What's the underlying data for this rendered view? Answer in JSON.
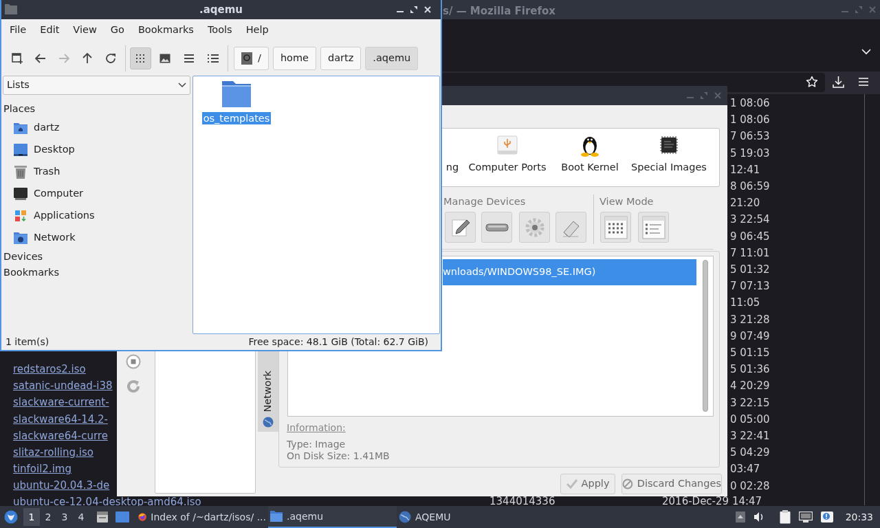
{
  "firefox": {
    "title": "s/ — Mozilla Firefox",
    "names": [
      "redstaros2.iso",
      "satanic-undead-i38",
      "slackware-current-",
      "slackware64-14.2-",
      "slackware64-curre",
      "slitaz-rolling.iso",
      "tinfoil2.img",
      "ubuntu-20.04.3-de",
      "ubuntu-ce-12.04-desktop-amd64.iso"
    ],
    "times": [
      "1 08:06",
      "1 08:06",
      "7 06:53",
      "5 19:03",
      "12:41",
      "8 06:59",
      "21:20",
      "3 22:54",
      "9 06:45",
      "7 11:01",
      "5 01:32",
      "7 07:13",
      "11:05",
      "3 21:28",
      "9 07:49",
      "5 01:15",
      "5 01:36",
      "4 20:29",
      "3 22:15",
      "0 05:00",
      "3 22:41",
      "5 04:29",
      "03:47",
      "0 02:28"
    ],
    "last_size": "1344014336",
    "last_date": "2016-Dec-29 14:47"
  },
  "aqemu": {
    "tool_items": [
      {
        "label": "ng",
        "kind": "hidden"
      },
      {
        "label": "Computer Ports",
        "kind": "usb"
      },
      {
        "label": "Boot Kernel",
        "kind": "penguin"
      },
      {
        "label": "Special Images",
        "kind": "chip"
      }
    ],
    "manage_label": "Manage Devices",
    "view_label": "View Mode",
    "devices": [
      {
        "label": "wnloads/WINDOWS98_SE.IMG)",
        "selected": true
      }
    ],
    "side_tab": "Network",
    "info_title": "Information:",
    "info_lines": [
      "Type: Image",
      "On Disk Size: 1.41MB"
    ],
    "buttons": [
      "Apply",
      "Discard Changes"
    ]
  },
  "file_manager": {
    "title": ".aqemu",
    "menu": [
      "File",
      "Edit",
      "View",
      "Go",
      "Bookmarks",
      "Tools",
      "Help"
    ],
    "nav_buttons": [
      {
        "disabled": false
      },
      {
        "disabled": true
      },
      {
        "disabled": false
      },
      {
        "disabled": false
      }
    ],
    "view_modes": [
      {
        "selected": true
      },
      {
        "selected": false
      },
      {
        "selected": false
      },
      {
        "selected": false
      }
    ],
    "path": [
      {
        "label": "/",
        "selected": false
      },
      {
        "label": "home",
        "selected": false
      },
      {
        "label": "dartz",
        "selected": false
      },
      {
        "label": ".aqemu",
        "selected": true
      }
    ],
    "side_mode": "Lists",
    "sections": [
      {
        "title": "Places",
        "items": [
          {
            "label": "dartz",
            "kind": "home"
          },
          {
            "label": "Desktop",
            "kind": "desktop"
          },
          {
            "label": "Trash",
            "kind": "trash"
          },
          {
            "label": "Computer",
            "kind": "computer"
          },
          {
            "label": "Applications",
            "kind": "apps"
          },
          {
            "label": "Network",
            "kind": "network"
          }
        ]
      },
      {
        "title": "Devices"
      },
      {
        "title": "Bookmarks"
      }
    ],
    "files": [
      {
        "name": "os_templates",
        "selected": true
      }
    ],
    "status_left": "1 item(s)",
    "status_right": "Free space: 48.1 GiB (Total: 62.7 GiB)"
  },
  "taskbar": {
    "workspaces": [
      {
        "label": "1",
        "selected": true
      },
      {
        "label": "2",
        "selected": false
      },
      {
        "label": "3",
        "selected": false
      },
      {
        "label": "4",
        "selected": false
      }
    ],
    "tasks": [
      {
        "label": "Index of /~dartz/isos/ ...",
        "kind": "firefox",
        "selected": false
      },
      {
        "label": ".aqemu",
        "kind": "folder",
        "selected": true
      },
      {
        "label": "AQEMU",
        "kind": "aqemu",
        "selected": false
      }
    ],
    "clock": "20:33"
  }
}
